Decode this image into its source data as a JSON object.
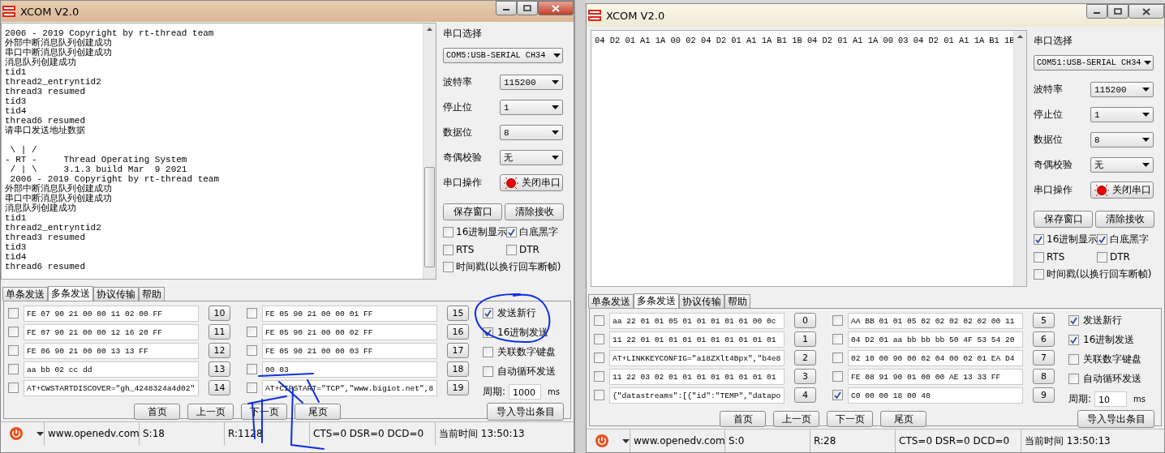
{
  "windows": [
    {
      "title": "XCOM V2.0",
      "pen_marks": true,
      "receive": [
        "2006 - 2019 Copyright by rt-thread team",
        "外部中断消息队列创建成功",
        "串口中断消息队列创建成功",
        "消息队列创建成功",
        "tid1",
        "thread2_entryntid2",
        "thread3 resumed",
        "tid3",
        "tid4",
        "thread6 resumed",
        "请串口发送地址数据",
        "\n \\ | /",
        "- RT -     Thread Operating System",
        " / | \\     3.1.3 build Mar  9 2021",
        " 2006 - 2019 Copyright by rt-thread team",
        "外部中断消息队列创建成功",
        "串口中断消息队列创建成功",
        "消息队列创建成功",
        "tid1",
        "thread2_entryntid2",
        "thread3 resumed",
        "tid3",
        "tid4",
        "thread6 resumed"
      ],
      "panel": {
        "port_label": "串口选择",
        "port": "COM5:USB-SERIAL CH34",
        "settings": [
          {
            "label": "波特率",
            "value": "115200"
          },
          {
            "label": "停止位",
            "value": "1"
          },
          {
            "label": "数据位",
            "value": "8"
          },
          {
            "label": "奇偶校验",
            "value": "无"
          }
        ],
        "operation_label": "串口操作",
        "operation_button": "关闭串口",
        "buttons": [
          "保存窗口",
          "清除接收"
        ],
        "options": [
          {
            "label": "16进制显示",
            "checked": false
          },
          {
            "label": "白底黑字",
            "checked": true
          },
          {
            "label": "RTS",
            "checked": false
          },
          {
            "label": "DTR",
            "checked": false
          },
          {
            "label": "时间戳(以换行回车断帧)",
            "checked": false
          }
        ]
      },
      "tabs": [
        {
          "label": "单条发送",
          "selected": false
        },
        {
          "label": "多条发送",
          "selected": true
        },
        {
          "label": "协议传输",
          "selected": false
        },
        {
          "label": "帮助",
          "selected": false
        }
      ],
      "send_rows": [
        {
          "checked": false,
          "text": "FE 07 90 21 00 00 11 02 00 FF",
          "button": "10"
        },
        {
          "checked": false,
          "text": "FE 07 90 21 00 00 12 16 20 FF",
          "button": "11"
        },
        {
          "checked": false,
          "text": "FE 06 90 21 00 00 13 13 FF",
          "button": "12"
        },
        {
          "checked": false,
          "text": "aa bb 02 cc dd",
          "button": "13"
        },
        {
          "checked": false,
          "text": "AT+CWSTARTDISCOVER=\"gh_4248324a4d02\"",
          "button": "14"
        },
        {
          "checked": false,
          "text": "FE 05 90 21 00 00 01 FF",
          "button": "15"
        },
        {
          "checked": false,
          "text": "FE 05 90 21 00 00 02 FF",
          "button": "16"
        },
        {
          "checked": false,
          "text": "FE 05 90 21 00 00 03 FF",
          "button": "17"
        },
        {
          "checked": false,
          "text": "00 03",
          "button": "18"
        },
        {
          "checked": false,
          "text": "AT+CIPSTART=\"TCP\",\"www.bigiot.net\",8",
          "button": "19"
        }
      ],
      "send_options": [
        {
          "label": "发送新行",
          "checked": true
        },
        {
          "label": "16进制发送",
          "checked": true
        },
        {
          "label": "关联数字键盘",
          "checked": false
        },
        {
          "label": "自动循环发送",
          "checked": false
        }
      ],
      "period_label": "周期:",
      "period": "1000",
      "period_unit": "ms",
      "nav": [
        "首页",
        "上一页",
        "下一页",
        "尾页"
      ],
      "import_button": "导入导出条目",
      "status": {
        "site": "www.openedv.com",
        "sent": "S:18",
        "received": "R:1128",
        "lines": "CTS=0 DSR=0 DCD=0",
        "time": "当前时间 13:50:13"
      }
    },
    {
      "title": "XCOM V2.0",
      "pen_marks": false,
      "receive": [
        "04 D2 01 A1 1A 00 02 04 D2 01 A1 1A B1 1B 04 D2 01 A1 1A 00 03 04 D2 01 A1 1A B1 1B"
      ],
      "panel": {
        "port_label": "串口选择",
        "port": "COM51:USB-SERIAL CH34",
        "settings": [
          {
            "label": "波特率",
            "value": "115200"
          },
          {
            "label": "停止位",
            "value": "1"
          },
          {
            "label": "数据位",
            "value": "8"
          },
          {
            "label": "奇偶校验",
            "value": "无"
          }
        ],
        "operation_label": "串口操作",
        "operation_button": "关闭串口",
        "buttons": [
          "保存窗口",
          "清除接收"
        ],
        "options": [
          {
            "label": "16进制显示",
            "checked": true
          },
          {
            "label": "白底黑字",
            "checked": true
          },
          {
            "label": "RTS",
            "checked": false
          },
          {
            "label": "DTR",
            "checked": false
          },
          {
            "label": "时间戳(以换行回车断帧)",
            "checked": false
          }
        ]
      },
      "tabs": [
        {
          "label": "单条发送",
          "selected": false
        },
        {
          "label": "多条发送",
          "selected": true
        },
        {
          "label": "协议传输",
          "selected": false
        },
        {
          "label": "帮助",
          "selected": false
        }
      ],
      "send_rows": [
        {
          "checked": false,
          "text": "aa 22 01 01 05 01 01 01 01 01 00 0c",
          "button": "0"
        },
        {
          "checked": false,
          "text": "11 22 01 01 01 01 01 01 01 01 01 01",
          "button": "1"
        },
        {
          "checked": false,
          "text": "AT+LINKKEYCONFIG=\"a18ZXlt4Bpx\",\"b4e8",
          "button": "2"
        },
        {
          "checked": false,
          "text": "11 22 03 02 01 01 01 01 01 01 01 01",
          "button": "3"
        },
        {
          "checked": false,
          "text": "{\"datastreams\":[{\"id\":\"TEMP\",\"datapo",
          "button": "4"
        },
        {
          "checked": false,
          "text": "AA BB 01 01 05 02 02 02 02 02 00 11",
          "button": "5"
        },
        {
          "checked": false,
          "text": "04 D2 01 aa bb bb bb 50 4F 53 54 20",
          "button": "6"
        },
        {
          "checked": false,
          "text": "02 10 00 90 00 02 04 00 02 01 EA D4",
          "button": "7"
        },
        {
          "checked": false,
          "text": "FE 08 91 90 01 00 00 AE 13 33 FF",
          "button": "8"
        },
        {
          "checked": true,
          "text": "C0 00 00 18 00 40",
          "button": "9"
        }
      ],
      "send_options": [
        {
          "label": "发送新行",
          "checked": true
        },
        {
          "label": "16进制发送",
          "checked": true
        },
        {
          "label": "关联数字键盘",
          "checked": false
        },
        {
          "label": "自动循环发送",
          "checked": false
        }
      ],
      "period_label": "周期:",
      "period": "10",
      "period_unit": "ms",
      "nav": [
        "首页",
        "上一页",
        "下一页",
        "尾页"
      ],
      "import_button": "导入导出条目",
      "status": {
        "site": "www.openedv.com",
        "sent": "S:0",
        "received": "R:28",
        "lines": "CTS=0 DSR=0 DCD=0",
        "time": "当前时间 13:50:13"
      }
    }
  ]
}
